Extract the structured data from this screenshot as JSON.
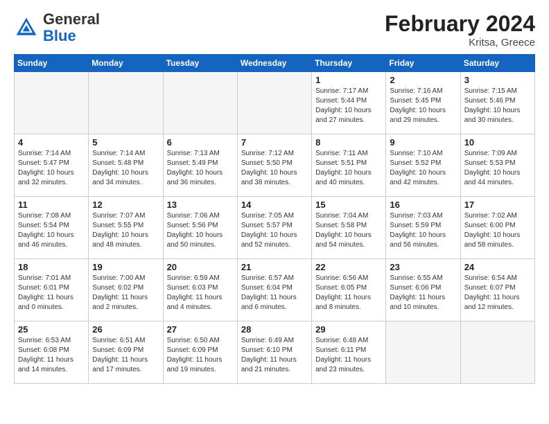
{
  "header": {
    "logo_general": "General",
    "logo_blue": "Blue",
    "month_title": "February 2024",
    "location": "Kritsa, Greece"
  },
  "days_of_week": [
    "Sunday",
    "Monday",
    "Tuesday",
    "Wednesday",
    "Thursday",
    "Friday",
    "Saturday"
  ],
  "weeks": [
    [
      {
        "day": "",
        "empty": true
      },
      {
        "day": "",
        "empty": true
      },
      {
        "day": "",
        "empty": true
      },
      {
        "day": "",
        "empty": true
      },
      {
        "day": "1",
        "sunrise": "7:17 AM",
        "sunset": "5:44 PM",
        "daylight": "10 hours and 27 minutes."
      },
      {
        "day": "2",
        "sunrise": "7:16 AM",
        "sunset": "5:45 PM",
        "daylight": "10 hours and 29 minutes."
      },
      {
        "day": "3",
        "sunrise": "7:15 AM",
        "sunset": "5:46 PM",
        "daylight": "10 hours and 30 minutes."
      }
    ],
    [
      {
        "day": "4",
        "sunrise": "7:14 AM",
        "sunset": "5:47 PM",
        "daylight": "10 hours and 32 minutes."
      },
      {
        "day": "5",
        "sunrise": "7:14 AM",
        "sunset": "5:48 PM",
        "daylight": "10 hours and 34 minutes."
      },
      {
        "day": "6",
        "sunrise": "7:13 AM",
        "sunset": "5:49 PM",
        "daylight": "10 hours and 36 minutes."
      },
      {
        "day": "7",
        "sunrise": "7:12 AM",
        "sunset": "5:50 PM",
        "daylight": "10 hours and 38 minutes."
      },
      {
        "day": "8",
        "sunrise": "7:11 AM",
        "sunset": "5:51 PM",
        "daylight": "10 hours and 40 minutes."
      },
      {
        "day": "9",
        "sunrise": "7:10 AM",
        "sunset": "5:52 PM",
        "daylight": "10 hours and 42 minutes."
      },
      {
        "day": "10",
        "sunrise": "7:09 AM",
        "sunset": "5:53 PM",
        "daylight": "10 hours and 44 minutes."
      }
    ],
    [
      {
        "day": "11",
        "sunrise": "7:08 AM",
        "sunset": "5:54 PM",
        "daylight": "10 hours and 46 minutes."
      },
      {
        "day": "12",
        "sunrise": "7:07 AM",
        "sunset": "5:55 PM",
        "daylight": "10 hours and 48 minutes."
      },
      {
        "day": "13",
        "sunrise": "7:06 AM",
        "sunset": "5:56 PM",
        "daylight": "10 hours and 50 minutes."
      },
      {
        "day": "14",
        "sunrise": "7:05 AM",
        "sunset": "5:57 PM",
        "daylight": "10 hours and 52 minutes."
      },
      {
        "day": "15",
        "sunrise": "7:04 AM",
        "sunset": "5:58 PM",
        "daylight": "10 hours and 54 minutes."
      },
      {
        "day": "16",
        "sunrise": "7:03 AM",
        "sunset": "5:59 PM",
        "daylight": "10 hours and 56 minutes."
      },
      {
        "day": "17",
        "sunrise": "7:02 AM",
        "sunset": "6:00 PM",
        "daylight": "10 hours and 58 minutes."
      }
    ],
    [
      {
        "day": "18",
        "sunrise": "7:01 AM",
        "sunset": "6:01 PM",
        "daylight": "11 hours and 0 minutes."
      },
      {
        "day": "19",
        "sunrise": "7:00 AM",
        "sunset": "6:02 PM",
        "daylight": "11 hours and 2 minutes."
      },
      {
        "day": "20",
        "sunrise": "6:59 AM",
        "sunset": "6:03 PM",
        "daylight": "11 hours and 4 minutes."
      },
      {
        "day": "21",
        "sunrise": "6:57 AM",
        "sunset": "6:04 PM",
        "daylight": "11 hours and 6 minutes."
      },
      {
        "day": "22",
        "sunrise": "6:56 AM",
        "sunset": "6:05 PM",
        "daylight": "11 hours and 8 minutes."
      },
      {
        "day": "23",
        "sunrise": "6:55 AM",
        "sunset": "6:06 PM",
        "daylight": "11 hours and 10 minutes."
      },
      {
        "day": "24",
        "sunrise": "6:54 AM",
        "sunset": "6:07 PM",
        "daylight": "11 hours and 12 minutes."
      }
    ],
    [
      {
        "day": "25",
        "sunrise": "6:53 AM",
        "sunset": "6:08 PM",
        "daylight": "11 hours and 14 minutes."
      },
      {
        "day": "26",
        "sunrise": "6:51 AM",
        "sunset": "6:09 PM",
        "daylight": "11 hours and 17 minutes."
      },
      {
        "day": "27",
        "sunrise": "6:50 AM",
        "sunset": "6:09 PM",
        "daylight": "11 hours and 19 minutes."
      },
      {
        "day": "28",
        "sunrise": "6:49 AM",
        "sunset": "6:10 PM",
        "daylight": "11 hours and 21 minutes."
      },
      {
        "day": "29",
        "sunrise": "6:48 AM",
        "sunset": "6:11 PM",
        "daylight": "11 hours and 23 minutes."
      },
      {
        "day": "",
        "empty": true
      },
      {
        "day": "",
        "empty": true
      }
    ]
  ]
}
